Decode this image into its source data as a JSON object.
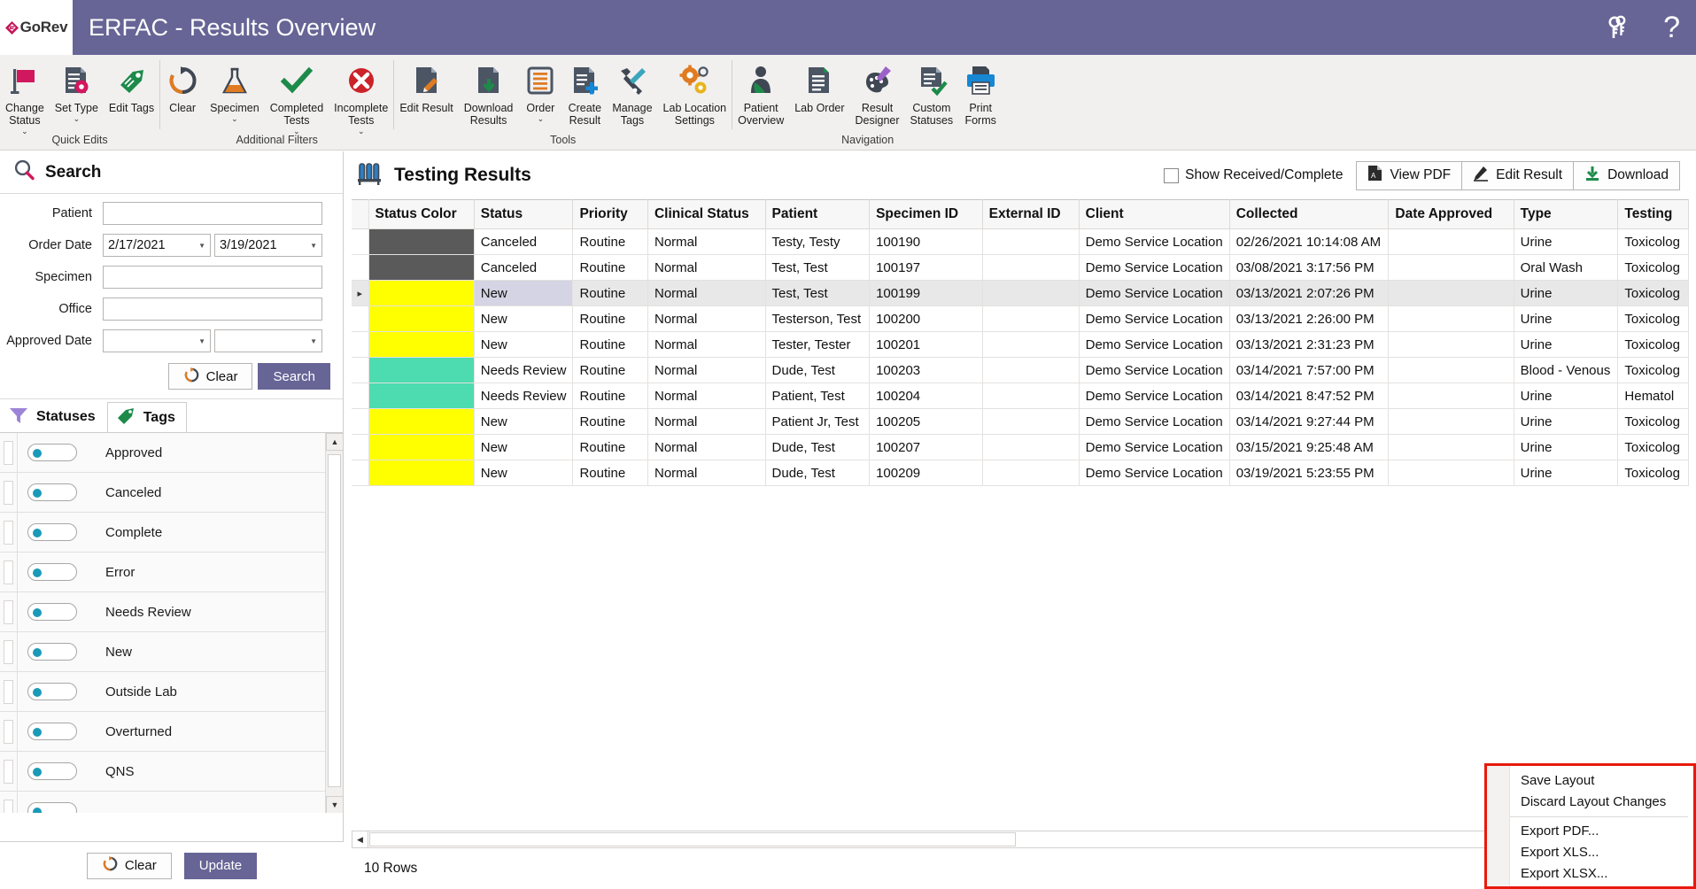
{
  "titlebar": {
    "logo_text": "GoRev",
    "title": "ERFAC - Results Overview",
    "keys_icon": "keys-icon",
    "help_label": "?"
  },
  "ribbon": {
    "groups": [
      {
        "label": "Quick Edits",
        "buttons": [
          {
            "label": "Change\nStatus",
            "icon": "flag-icon",
            "caret": "⌄"
          },
          {
            "label": "Set Type",
            "icon": "document-gear-icon",
            "caret": "⌄"
          },
          {
            "label": "Edit Tags",
            "icon": "tag-icon",
            "caret": ""
          }
        ]
      },
      {
        "label": "Additional Filters",
        "buttons": [
          {
            "label": "Clear",
            "icon": "refresh-icon",
            "caret": ""
          },
          {
            "label": "Specimen",
            "icon": "flask-icon",
            "caret": "⌄"
          },
          {
            "label": "Completed\nTests",
            "icon": "check-icon",
            "caret": "⌄"
          },
          {
            "label": "Incomplete\nTests",
            "icon": "error-circle-icon",
            "caret": "⌄"
          }
        ]
      },
      {
        "label": "Tools",
        "buttons": [
          {
            "label": "Edit Result",
            "icon": "document-pencil-icon",
            "caret": ""
          },
          {
            "label": "Download\nResults",
            "icon": "document-download-icon",
            "caret": ""
          },
          {
            "label": "Order",
            "icon": "order-list-icon",
            "caret": "⌄"
          },
          {
            "label": "Create\nResult",
            "icon": "document-plus-icon",
            "caret": ""
          },
          {
            "label": "Manage\nTags",
            "icon": "tools-icon",
            "caret": ""
          },
          {
            "label": "Lab Location\nSettings",
            "icon": "gears-icon",
            "caret": ""
          }
        ]
      },
      {
        "label": "Navigation",
        "buttons": [
          {
            "label": "Patient\nOverview",
            "icon": "patient-icon",
            "caret": ""
          },
          {
            "label": "Lab Order",
            "icon": "lab-order-icon",
            "caret": ""
          },
          {
            "label": "Result\nDesigner",
            "icon": "palette-icon",
            "caret": ""
          },
          {
            "label": "Custom\nStatuses",
            "icon": "document-check-icon",
            "caret": ""
          },
          {
            "label": "Print\nForms",
            "icon": "printer-icon",
            "caret": ""
          }
        ]
      }
    ]
  },
  "search": {
    "heading": "Search",
    "heading_icon": "magnifier-icon",
    "fields": {
      "patient_label": "Patient",
      "patient_value": "",
      "order_date_label": "Order Date",
      "order_date_from": "2/17/2021",
      "order_date_to": "3/19/2021",
      "specimen_label": "Specimen",
      "specimen_value": "",
      "office_label": "Office",
      "office_value": "",
      "approved_date_label": "Approved Date",
      "approved_date_from": "",
      "approved_date_to": ""
    },
    "clear_label": "Clear",
    "search_label": "Search"
  },
  "filter_tabs": {
    "statuses_label": "Statuses",
    "statuses_icon": "funnel-icon",
    "tags_label": "Tags",
    "tags_icon": "tag-icon"
  },
  "statuses": [
    {
      "label": "Approved"
    },
    {
      "label": "Canceled"
    },
    {
      "label": "Complete"
    },
    {
      "label": "Error"
    },
    {
      "label": "Needs Review"
    },
    {
      "label": "New"
    },
    {
      "label": "Outside Lab"
    },
    {
      "label": "Overturned"
    },
    {
      "label": "QNS"
    }
  ],
  "left_footer": {
    "clear_label": "Clear",
    "update_label": "Update"
  },
  "main": {
    "title": "Testing Results",
    "title_icon": "test-tubes-icon",
    "show_received_label": "Show Received/Complete",
    "show_received_checked": false,
    "view_pdf_label": "View PDF",
    "view_pdf_icon": "pdf-icon",
    "edit_result_label": "Edit Result",
    "edit_result_icon": "pencil-icon",
    "download_label": "Download",
    "download_icon": "download-icon",
    "row_count": "10 Rows"
  },
  "table": {
    "columns": [
      "Status Color",
      "Status",
      "Priority",
      "Clinical Status",
      "Patient",
      "Specimen ID",
      "External ID",
      "Client",
      "Collected",
      "Date Approved",
      "Type",
      "Testing"
    ],
    "rows": [
      {
        "color": "#5a5a5a",
        "status": "Canceled",
        "priority": "Routine",
        "clinical_status": "Normal",
        "patient": "Testy, Testy",
        "specimen_id": "100190",
        "external_id": "",
        "client": "Demo Service Location",
        "collected": "02/26/2021 10:14:08 AM",
        "date_approved": "",
        "type": "Urine",
        "testing": "Toxicolog",
        "selected": false
      },
      {
        "color": "#5a5a5a",
        "status": "Canceled",
        "priority": "Routine",
        "clinical_status": "Normal",
        "patient": "Test, Test",
        "specimen_id": "100197",
        "external_id": "",
        "client": "Demo Service Location",
        "collected": "03/08/2021 3:17:56 PM",
        "date_approved": "",
        "type": "Oral Wash",
        "testing": "Toxicolog",
        "selected": false
      },
      {
        "color": "#ffff00",
        "status": "New",
        "priority": "Routine",
        "clinical_status": "Normal",
        "patient": "Test, Test",
        "specimen_id": "100199",
        "external_id": "",
        "client": "Demo Service Location",
        "collected": "03/13/2021 2:07:26 PM",
        "date_approved": "",
        "type": "Urine",
        "testing": "Toxicolog",
        "selected": true
      },
      {
        "color": "#ffff00",
        "status": "New",
        "priority": "Routine",
        "clinical_status": "Normal",
        "patient": "Testerson, Test",
        "specimen_id": "100200",
        "external_id": "",
        "client": "Demo Service Location",
        "collected": "03/13/2021 2:26:00 PM",
        "date_approved": "",
        "type": "Urine",
        "testing": "Toxicolog",
        "selected": false
      },
      {
        "color": "#ffff00",
        "status": "New",
        "priority": "Routine",
        "clinical_status": "Normal",
        "patient": "Tester, Tester",
        "specimen_id": "100201",
        "external_id": "",
        "client": "Demo Service Location",
        "collected": "03/13/2021 2:31:23 PM",
        "date_approved": "",
        "type": "Urine",
        "testing": "Toxicolog",
        "selected": false
      },
      {
        "color": "#4ddbb0",
        "status": "Needs Review",
        "priority": "Routine",
        "clinical_status": "Normal",
        "patient": "Dude, Test",
        "specimen_id": "100203",
        "external_id": "",
        "client": "Demo Service Location",
        "collected": "03/14/2021 7:57:00 PM",
        "date_approved": "",
        "type": "Blood - Venous",
        "testing": "Toxicolog",
        "selected": false
      },
      {
        "color": "#4ddbb0",
        "status": "Needs Review",
        "priority": "Routine",
        "clinical_status": "Normal",
        "patient": "Patient, Test",
        "specimen_id": "100204",
        "external_id": "",
        "client": "Demo Service Location",
        "collected": "03/14/2021 8:47:52 PM",
        "date_approved": "",
        "type": "Urine",
        "testing": "Hematol",
        "selected": false
      },
      {
        "color": "#ffff00",
        "status": "New",
        "priority": "Routine",
        "clinical_status": "Normal",
        "patient": "Patient Jr, Test",
        "specimen_id": "100205",
        "external_id": "",
        "client": "Demo Service Location",
        "collected": "03/14/2021 9:27:44 PM",
        "date_approved": "",
        "type": "Urine",
        "testing": "Toxicolog",
        "selected": false
      },
      {
        "color": "#ffff00",
        "status": "New",
        "priority": "Routine",
        "clinical_status": "Normal",
        "patient": "Dude, Test",
        "specimen_id": "100207",
        "external_id": "",
        "client": "Demo Service Location",
        "collected": "03/15/2021 9:25:48 AM",
        "date_approved": "",
        "type": "Urine",
        "testing": "Toxicolog",
        "selected": false
      },
      {
        "color": "#ffff00",
        "status": "New",
        "priority": "Routine",
        "clinical_status": "Normal",
        "patient": "Dude, Test",
        "specimen_id": "100209",
        "external_id": "",
        "client": "Demo Service Location",
        "collected": "03/19/2021 5:23:55 PM",
        "date_approved": "",
        "type": "Urine",
        "testing": "Toxicolog",
        "selected": false
      }
    ]
  },
  "context_menu": {
    "items": [
      {
        "label": "Save Layout",
        "separator_after": false
      },
      {
        "label": "Discard Layout Changes",
        "separator_after": true
      },
      {
        "label": "Export PDF...",
        "separator_after": false
      },
      {
        "label": "Export XLS...",
        "separator_after": false
      },
      {
        "label": "Export XLSX...",
        "separator_after": false
      }
    ]
  },
  "colors": {
    "brand_purple": "#676596",
    "accent_pink": "#d1185e",
    "accent_orange": "#e07b21",
    "accent_green": "#1d8a4a",
    "highlight_red": "#e8190c"
  }
}
